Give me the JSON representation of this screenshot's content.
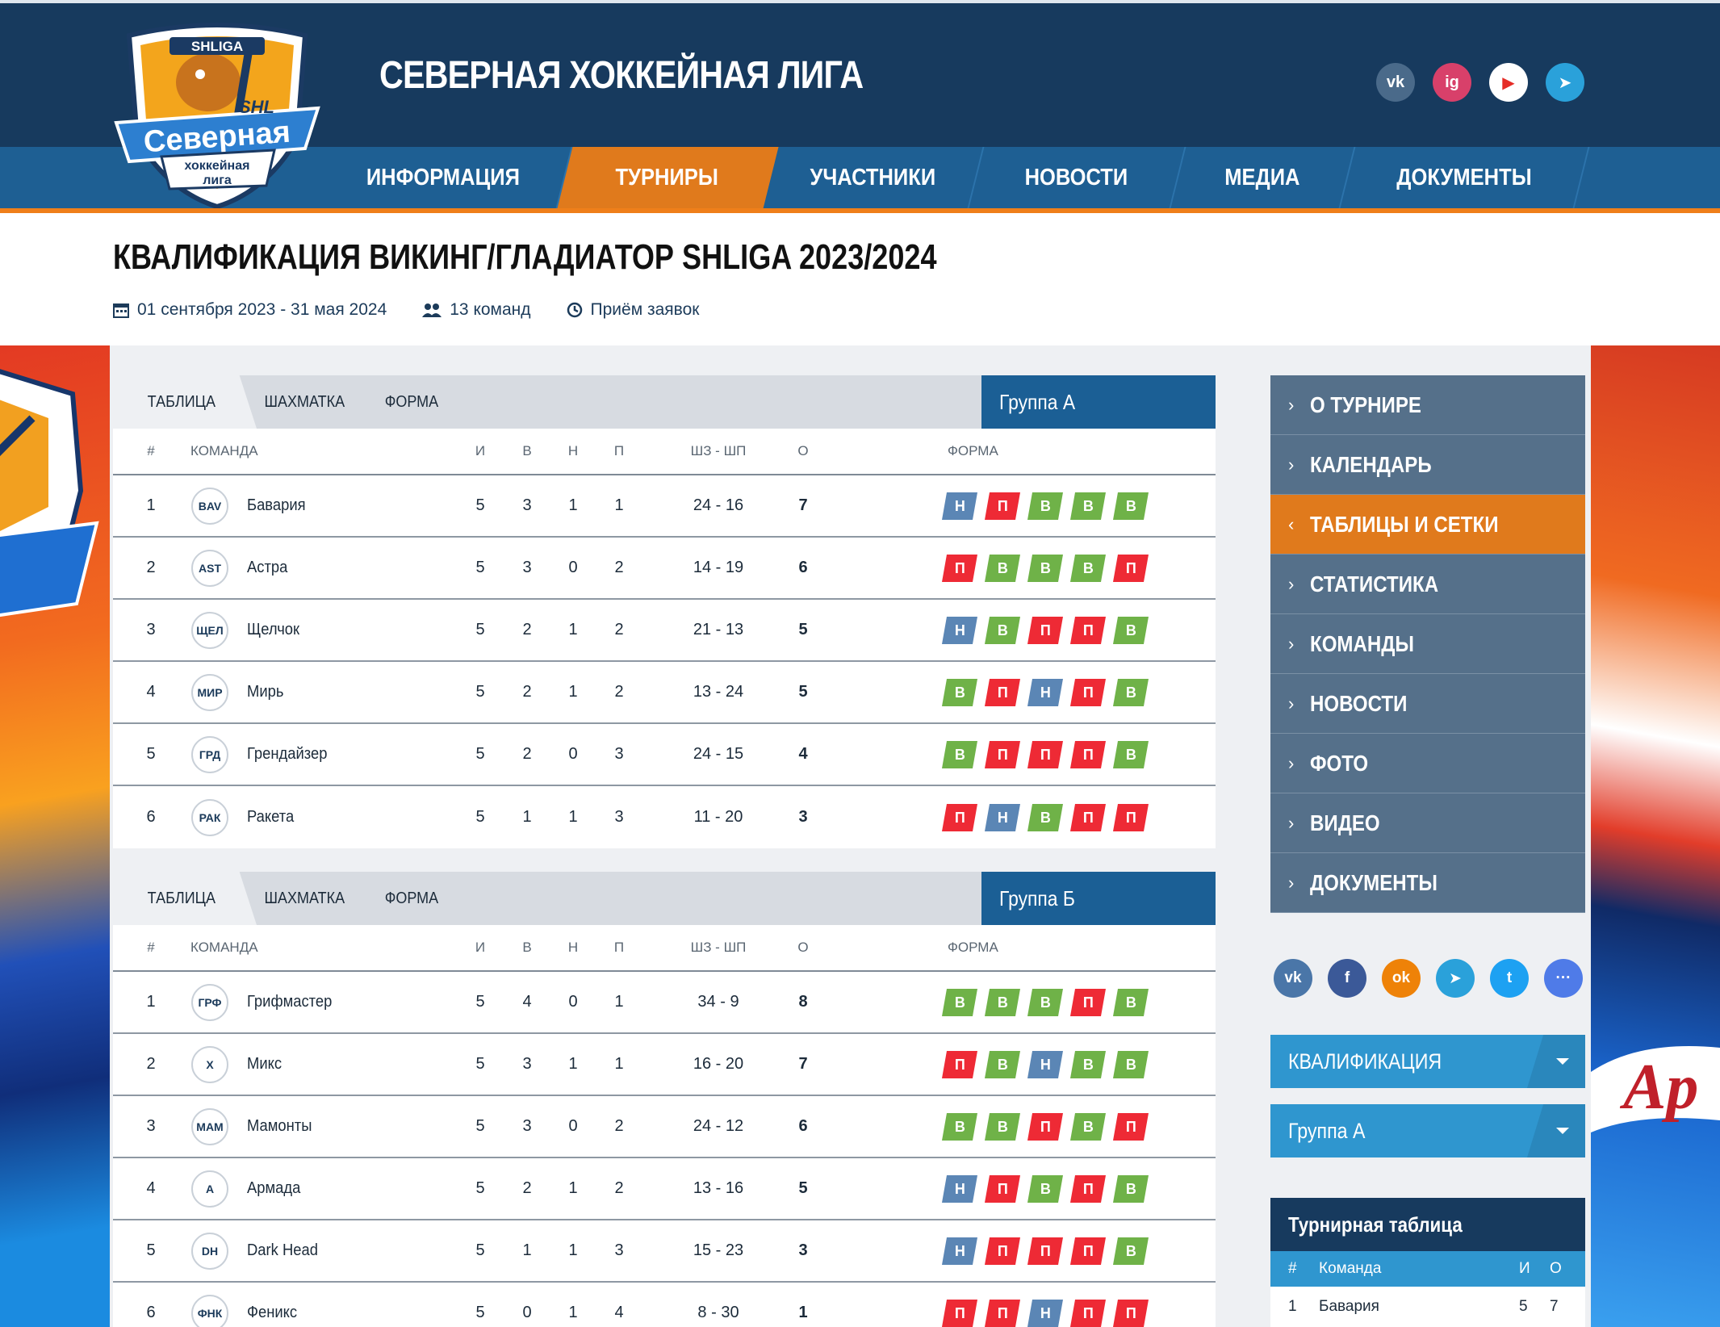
{
  "site": {
    "title": "СЕВЕРНАЯ ХОККЕЙНАЯ ЛИГА",
    "logo_text": {
      "top": "SHLIGA",
      "main": "Северная",
      "sub1": "хоккейная",
      "sub2": "лига",
      "mark": "SHL"
    }
  },
  "header_socials": [
    {
      "name": "vk",
      "label": "vk",
      "color": "#4a6a8a"
    },
    {
      "name": "instagram",
      "label": "ig",
      "color": "#d8406a"
    },
    {
      "name": "youtube",
      "label": "▶",
      "color": "#ffffff"
    },
    {
      "name": "telegram",
      "label": "➤",
      "color": "#2aa1da"
    }
  ],
  "nav": [
    {
      "label": "ИНФОРМАЦИЯ",
      "active": false
    },
    {
      "label": "ТУРНИРЫ",
      "active": true
    },
    {
      "label": "УЧАСТНИКИ",
      "active": false
    },
    {
      "label": "НОВОСТИ",
      "active": false
    },
    {
      "label": "МЕДИА",
      "active": false
    },
    {
      "label": "ДОКУМЕНТЫ",
      "active": false
    }
  ],
  "tournament": {
    "title": "КВАЛИФИКАЦИЯ ВИКИНГ/ГЛАДИАТОР SHLIGA 2023/2024",
    "dates": "01 сентября 2023 - 31 мая 2024",
    "teams": "13 команд",
    "status": "Приём заявок"
  },
  "tabs": [
    "ТАБЛИЦА",
    "ШАХМАТКА",
    "ФОРМА"
  ],
  "columns": {
    "num": "#",
    "team": "КОМАНДА",
    "i": "И",
    "v": "В",
    "n": "Н",
    "p": "П",
    "sh": "ШЗ - ШП",
    "o": "О",
    "form": "ФОРМА"
  },
  "groups": [
    {
      "label": "Группа А",
      "rows": [
        {
          "num": "1",
          "team": "Бавария",
          "logo": "BAV",
          "i": "5",
          "v": "3",
          "n": "1",
          "p": "1",
          "sh": "24 - 16",
          "o": "7",
          "form": [
            "Н",
            "П",
            "В",
            "В",
            "В"
          ]
        },
        {
          "num": "2",
          "team": "Астра",
          "logo": "AST",
          "i": "5",
          "v": "3",
          "n": "0",
          "p": "2",
          "sh": "14 - 19",
          "o": "6",
          "form": [
            "П",
            "В",
            "В",
            "В",
            "П"
          ]
        },
        {
          "num": "3",
          "team": "Щелчок",
          "logo": "ЩЕЛ",
          "i": "5",
          "v": "2",
          "n": "1",
          "p": "2",
          "sh": "21 - 13",
          "o": "5",
          "form": [
            "Н",
            "В",
            "П",
            "П",
            "В"
          ]
        },
        {
          "num": "4",
          "team": "Мирь",
          "logo": "МИР",
          "i": "5",
          "v": "2",
          "n": "1",
          "p": "2",
          "sh": "13 - 24",
          "o": "5",
          "form": [
            "В",
            "П",
            "Н",
            "П",
            "В"
          ]
        },
        {
          "num": "5",
          "team": "Грендайзер",
          "logo": "ГРД",
          "i": "5",
          "v": "2",
          "n": "0",
          "p": "3",
          "sh": "24 - 15",
          "o": "4",
          "form": [
            "В",
            "П",
            "П",
            "П",
            "В"
          ]
        },
        {
          "num": "6",
          "team": "Ракета",
          "logo": "РАК",
          "i": "5",
          "v": "1",
          "n": "1",
          "p": "3",
          "sh": "11 - 20",
          "o": "3",
          "form": [
            "П",
            "Н",
            "В",
            "П",
            "П"
          ]
        }
      ]
    },
    {
      "label": "Группа Б",
      "rows": [
        {
          "num": "1",
          "team": "Грифмастер",
          "logo": "ГРФ",
          "i": "5",
          "v": "4",
          "n": "0",
          "p": "1",
          "sh": "34 - 9",
          "o": "8",
          "form": [
            "В",
            "В",
            "В",
            "П",
            "В"
          ]
        },
        {
          "num": "2",
          "team": "Микс",
          "logo": "X",
          "i": "5",
          "v": "3",
          "n": "1",
          "p": "1",
          "sh": "16 - 20",
          "o": "7",
          "form": [
            "П",
            "В",
            "Н",
            "В",
            "В"
          ]
        },
        {
          "num": "3",
          "team": "Мамонты",
          "logo": "МАМ",
          "i": "5",
          "v": "3",
          "n": "0",
          "p": "2",
          "sh": "24 - 12",
          "o": "6",
          "form": [
            "В",
            "В",
            "П",
            "В",
            "П"
          ]
        },
        {
          "num": "4",
          "team": "Армада",
          "logo": "A",
          "i": "5",
          "v": "2",
          "n": "1",
          "p": "2",
          "sh": "13 - 16",
          "o": "5",
          "form": [
            "Н",
            "П",
            "В",
            "П",
            "В"
          ]
        },
        {
          "num": "5",
          "team": "Dark Head",
          "logo": "DH",
          "i": "5",
          "v": "1",
          "n": "1",
          "p": "3",
          "sh": "15 - 23",
          "o": "3",
          "form": [
            "Н",
            "П",
            "П",
            "П",
            "В"
          ]
        },
        {
          "num": "6",
          "team": "Феникс",
          "logo": "ФНК",
          "i": "5",
          "v": "0",
          "n": "1",
          "p": "4",
          "sh": "8 - 30",
          "o": "1",
          "form": [
            "П",
            "П",
            "Н",
            "П",
            "П"
          ]
        }
      ]
    }
  ],
  "sidebar": {
    "menu": [
      {
        "label": "О ТУРНИРЕ",
        "active": false,
        "chev": "›"
      },
      {
        "label": "КАЛЕНДАРЬ",
        "active": false,
        "chev": "›"
      },
      {
        "label": "ТАБЛИЦЫ И СЕТКИ",
        "active": true,
        "chev": "‹"
      },
      {
        "label": "СТАТИСТИКА",
        "active": false,
        "chev": "›"
      },
      {
        "label": "КОМАНДЫ",
        "active": false,
        "chev": "›"
      },
      {
        "label": "НОВОСТИ",
        "active": false,
        "chev": "›"
      },
      {
        "label": "ФОТО",
        "active": false,
        "chev": "›"
      },
      {
        "label": "ВИДЕО",
        "active": false,
        "chev": "›"
      },
      {
        "label": "ДОКУМЕНТЫ",
        "active": false,
        "chev": "›"
      }
    ],
    "share": [
      {
        "name": "vk",
        "label": "vk",
        "color": "#4a76a8"
      },
      {
        "name": "facebook",
        "label": "f",
        "color": "#3b5998"
      },
      {
        "name": "odnoklassniki",
        "label": "ok",
        "color": "#ee8208"
      },
      {
        "name": "telegram",
        "label": "➤",
        "color": "#2aa1da"
      },
      {
        "name": "twitter",
        "label": "t",
        "color": "#1da1f2"
      },
      {
        "name": "more",
        "label": "···",
        "color": "#4f7be8"
      }
    ],
    "stage_select": "КВАЛИФИКАЦИЯ",
    "group_select": "Группа А",
    "mini_table": {
      "title": "Турнирная таблица",
      "head": {
        "num": "#",
        "team": "Команда",
        "i": "И",
        "o": "О"
      },
      "rows": [
        {
          "num": "1",
          "team": "Бавария",
          "i": "5",
          "o": "7"
        }
      ]
    }
  },
  "colors": {
    "win": "#6fb248",
    "loss": "#ee2a35",
    "draw": "#5b86b5",
    "accent": "#e07a1c",
    "navy": "#173a5e"
  }
}
